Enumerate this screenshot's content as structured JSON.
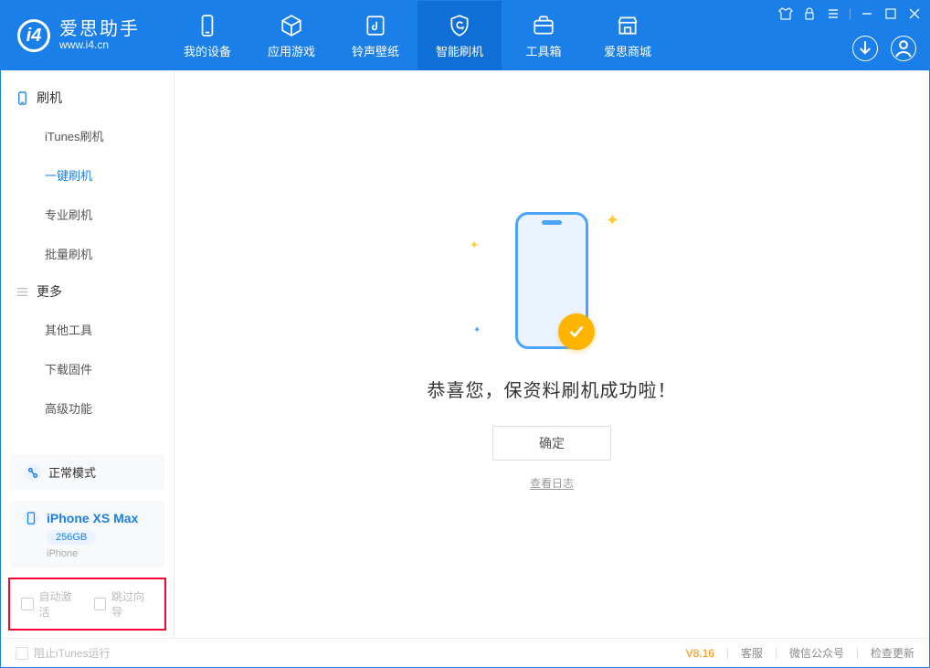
{
  "brand": {
    "title": "爱思助手",
    "subtitle": "www.i4.cn"
  },
  "nav": {
    "items": [
      {
        "label": "我的设备"
      },
      {
        "label": "应用游戏"
      },
      {
        "label": "铃声壁纸"
      },
      {
        "label": "智能刷机"
      },
      {
        "label": "工具箱"
      },
      {
        "label": "爱思商城"
      }
    ]
  },
  "sidebar": {
    "group1": {
      "title": "刷机",
      "items": [
        "iTunes刷机",
        "一键刷机",
        "专业刷机",
        "批量刷机"
      ]
    },
    "group2": {
      "title": "更多",
      "items": [
        "其他工具",
        "下载固件",
        "高级功能"
      ]
    }
  },
  "mode": {
    "label": "正常模式"
  },
  "device": {
    "name": "iPhone XS Max",
    "capacity": "256GB",
    "type": "iPhone"
  },
  "options": {
    "auto_activate": "自动激活",
    "skip_guide": "跳过向导"
  },
  "main": {
    "success_text": "恭喜您，保资料刷机成功啦！",
    "ok_label": "确定",
    "log_link": "查看日志"
  },
  "footer": {
    "block_itunes": "阻止iTunes运行",
    "version": "V8.16",
    "links": [
      "客服",
      "微信公众号",
      "检查更新"
    ]
  }
}
